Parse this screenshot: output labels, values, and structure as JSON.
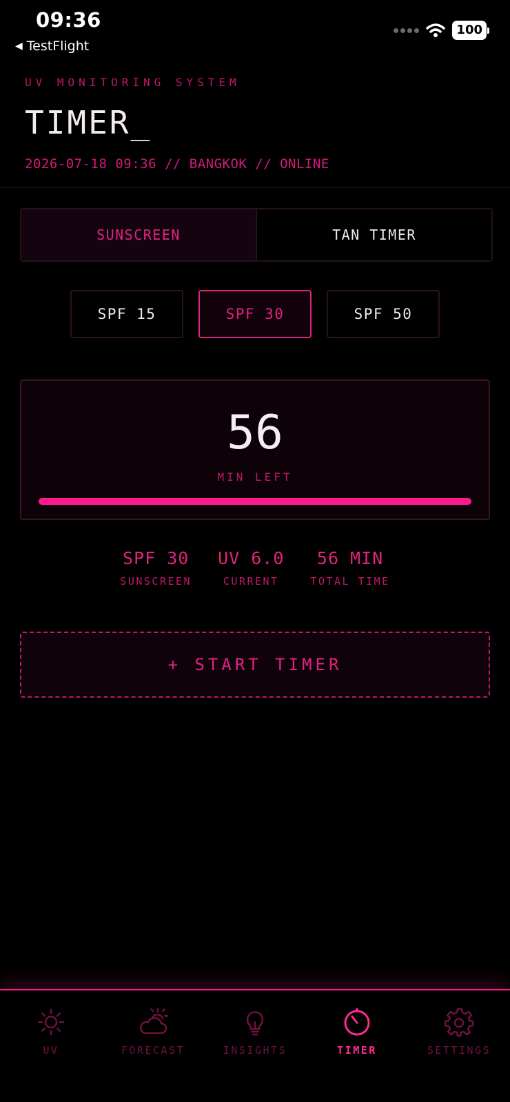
{
  "status_bar": {
    "time": "09:36",
    "back_label": "TestFlight",
    "battery": "100"
  },
  "header": {
    "eyebrow": "UV MONITORING SYSTEM",
    "title": "TIMER_",
    "meta": "2026-07-18 09:36 // BANGKOK // ONLINE"
  },
  "mode_tabs": [
    {
      "label": "SUNSCREEN",
      "active": true
    },
    {
      "label": "TAN TIMER",
      "active": false
    }
  ],
  "spf_options": [
    {
      "label": "SPF 15",
      "selected": false
    },
    {
      "label": "SPF 30",
      "selected": true
    },
    {
      "label": "SPF 50",
      "selected": false
    }
  ],
  "timer": {
    "value": "56",
    "unit": "MIN LEFT",
    "progress_fraction": 1.0
  },
  "stats": [
    {
      "value": "SPF 30",
      "label": "SUNSCREEN"
    },
    {
      "value": "UV 6.0",
      "label": "CURRENT"
    },
    {
      "value": "56 MIN",
      "label": "TOTAL TIME"
    }
  ],
  "start_button_label": "+ START TIMER",
  "tab_bar": [
    {
      "label": "UV",
      "icon": "sun-icon",
      "active": false
    },
    {
      "label": "FORECAST",
      "icon": "cloud-sun-icon",
      "active": false
    },
    {
      "label": "INSIGHTS",
      "icon": "lightbulb-icon",
      "active": false
    },
    {
      "label": "TIMER",
      "icon": "timer-icon",
      "active": true
    },
    {
      "label": "SETTINGS",
      "icon": "gear-icon",
      "active": false
    }
  ],
  "colors": {
    "accent": "#ff1a8c",
    "accent_dim": "#c0186c",
    "background": "#000000"
  }
}
